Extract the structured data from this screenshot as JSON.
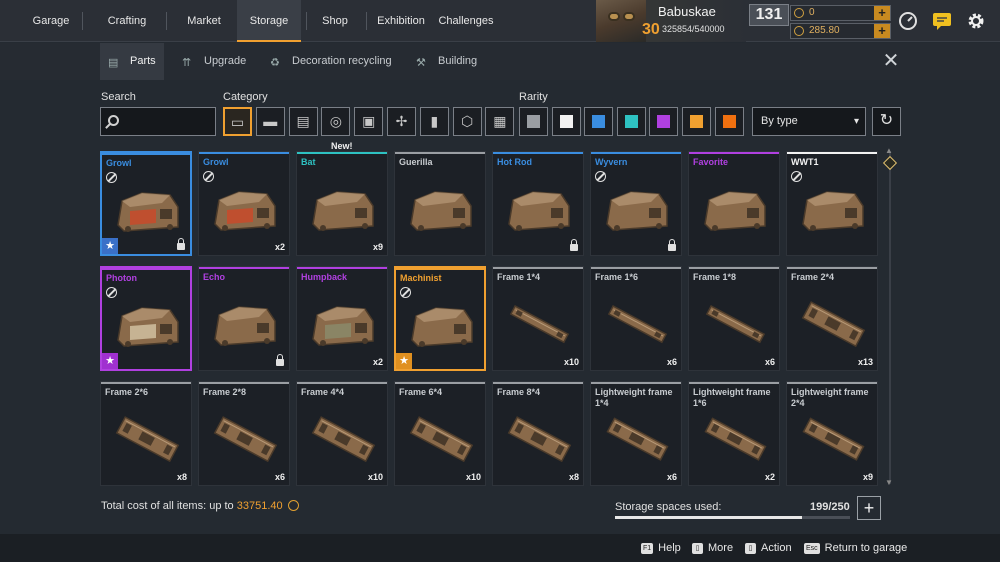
{
  "nav": {
    "tabs": [
      {
        "label": "Garage"
      },
      {
        "label": "Crafting"
      },
      {
        "label": "Market"
      },
      {
        "label": "Storage",
        "active": true
      },
      {
        "label": "Shop"
      },
      {
        "label": "Exhibition"
      },
      {
        "label": "Challenges"
      }
    ]
  },
  "player": {
    "name": "Babuskae",
    "level": "30",
    "xp": "325854/540000",
    "power_score": "131"
  },
  "currencies": [
    {
      "name": "coupons",
      "value": "0"
    },
    {
      "name": "coins",
      "value": "285.80"
    }
  ],
  "subtabs": [
    {
      "label": "Parts",
      "icon": "parts-icon",
      "active": true
    },
    {
      "label": "Upgrade",
      "icon": "upgrade-icon"
    },
    {
      "label": "Decoration recycling",
      "icon": "recycling-icon"
    },
    {
      "label": "Building",
      "icon": "building-icon"
    }
  ],
  "filters": {
    "search_label": "Search",
    "search_placeholder": "",
    "category_label": "Category",
    "categories": [
      "cabins-icon",
      "weapons-icon",
      "modules-icon",
      "wheels-icon",
      "frames-icon",
      "decor-icon",
      "paint-icon",
      "stickers-icon",
      "all-icon"
    ],
    "rarity_label": "Rarity",
    "rarities": [
      {
        "name": "common",
        "color": "#9a9ea3"
      },
      {
        "name": "white",
        "color": "#f2f2f2"
      },
      {
        "name": "rare",
        "color": "#3a8de0"
      },
      {
        "name": "special",
        "color": "#2ec2c2"
      },
      {
        "name": "epic",
        "color": "#b040e0"
      },
      {
        "name": "legendary",
        "color": "#f0a030"
      },
      {
        "name": "relic",
        "color": "#f07010"
      }
    ],
    "sort_value": "By type"
  },
  "new_badge": "New!",
  "items": [
    {
      "name": "Growl",
      "color": "#3a8de0",
      "ban": true,
      "lock": true,
      "star": "blue",
      "qty": "",
      "sel": "blue",
      "kind": "cab-red"
    },
    {
      "name": "Growl",
      "color": "#3a8de0",
      "ban": true,
      "lock": false,
      "qty": "x2",
      "kind": "cab-red"
    },
    {
      "name": "Bat",
      "color": "#2ec2c2",
      "ban": false,
      "lock": false,
      "qty": "x9",
      "kind": "cab-rust"
    },
    {
      "name": "Guerilla",
      "color": "#9a9ea3",
      "ban": false,
      "lock": false,
      "qty": "",
      "kind": "cab-truck"
    },
    {
      "name": "Hot Rod",
      "color": "#3a8de0",
      "ban": false,
      "lock": true,
      "qty": "",
      "kind": "cab-rod"
    },
    {
      "name": "Wyvern",
      "color": "#3a8de0",
      "ban": true,
      "lock": true,
      "qty": "",
      "kind": "cab-wyvern"
    },
    {
      "name": "Favorite",
      "color": "#b040e0",
      "ban": false,
      "lock": false,
      "qty": "",
      "kind": "cab-fav"
    },
    {
      "name": "WWT1",
      "color": "#f2f2f2",
      "ban": true,
      "lock": false,
      "qty": "",
      "kind": "cab-van"
    },
    {
      "name": "Photon",
      "color": "#b040e0",
      "ban": true,
      "lock": false,
      "star": "purple",
      "qty": "",
      "sel": "purple",
      "kind": "cab-photon"
    },
    {
      "name": "Echo",
      "color": "#b040e0",
      "ban": false,
      "lock": true,
      "qty": "",
      "kind": "cab-echo"
    },
    {
      "name": "Humpback",
      "color": "#b040e0",
      "ban": false,
      "lock": false,
      "qty": "x2",
      "kind": "cab-hump"
    },
    {
      "name": "Machinist",
      "color": "#f0a030",
      "ban": true,
      "lock": false,
      "star": "orange",
      "qty": "",
      "sel": "orange",
      "kind": "cab-mach"
    },
    {
      "name": "Frame 1*4",
      "color": "#9a9ea3",
      "ban": false,
      "lock": false,
      "qty": "x10",
      "kind": "frame-s"
    },
    {
      "name": "Frame 1*6",
      "color": "#9a9ea3",
      "ban": false,
      "lock": false,
      "qty": "x6",
      "kind": "frame-s"
    },
    {
      "name": "Frame 1*8",
      "color": "#9a9ea3",
      "ban": false,
      "lock": false,
      "qty": "x6",
      "kind": "frame-s"
    },
    {
      "name": "Frame 2*4",
      "color": "#9a9ea3",
      "ban": false,
      "lock": false,
      "qty": "x13",
      "kind": "frame-w"
    },
    {
      "name": "Frame 2*6",
      "color": "#9a9ea3",
      "ban": false,
      "lock": false,
      "qty": "x8",
      "kind": "frame-w"
    },
    {
      "name": "Frame 2*8",
      "color": "#9a9ea3",
      "ban": false,
      "lock": false,
      "qty": "x6",
      "kind": "frame-w"
    },
    {
      "name": "Frame 4*4",
      "color": "#9a9ea3",
      "ban": false,
      "lock": false,
      "qty": "x10",
      "kind": "frame-w"
    },
    {
      "name": "Frame 6*4",
      "color": "#9a9ea3",
      "ban": false,
      "lock": false,
      "qty": "x10",
      "kind": "frame-w"
    },
    {
      "name": "Frame 8*4",
      "color": "#9a9ea3",
      "ban": false,
      "lock": false,
      "qty": "x8",
      "kind": "frame-w"
    },
    {
      "name": "Lightweight frame 1*4",
      "color": "#9a9ea3",
      "ban": false,
      "lock": false,
      "qty": "x6",
      "kind": "frame-l"
    },
    {
      "name": "Lightweight frame 1*6",
      "color": "#9a9ea3",
      "ban": false,
      "lock": false,
      "qty": "x2",
      "kind": "frame-l"
    },
    {
      "name": "Lightweight frame 2*4",
      "color": "#9a9ea3",
      "ban": false,
      "lock": false,
      "qty": "x9",
      "kind": "frame-l"
    }
  ],
  "summary": {
    "total_label": "Total cost of all items: up to",
    "total_value": "33751.40",
    "storage_label": "Storage spaces used:",
    "storage_value": "199/250",
    "storage_fraction": 0.796
  },
  "footer": [
    {
      "key": "F1",
      "label": "Help"
    },
    {
      "key": "",
      "label": "More"
    },
    {
      "key": "",
      "label": "Action"
    },
    {
      "key": "Esc",
      "label": "Return to garage"
    }
  ]
}
